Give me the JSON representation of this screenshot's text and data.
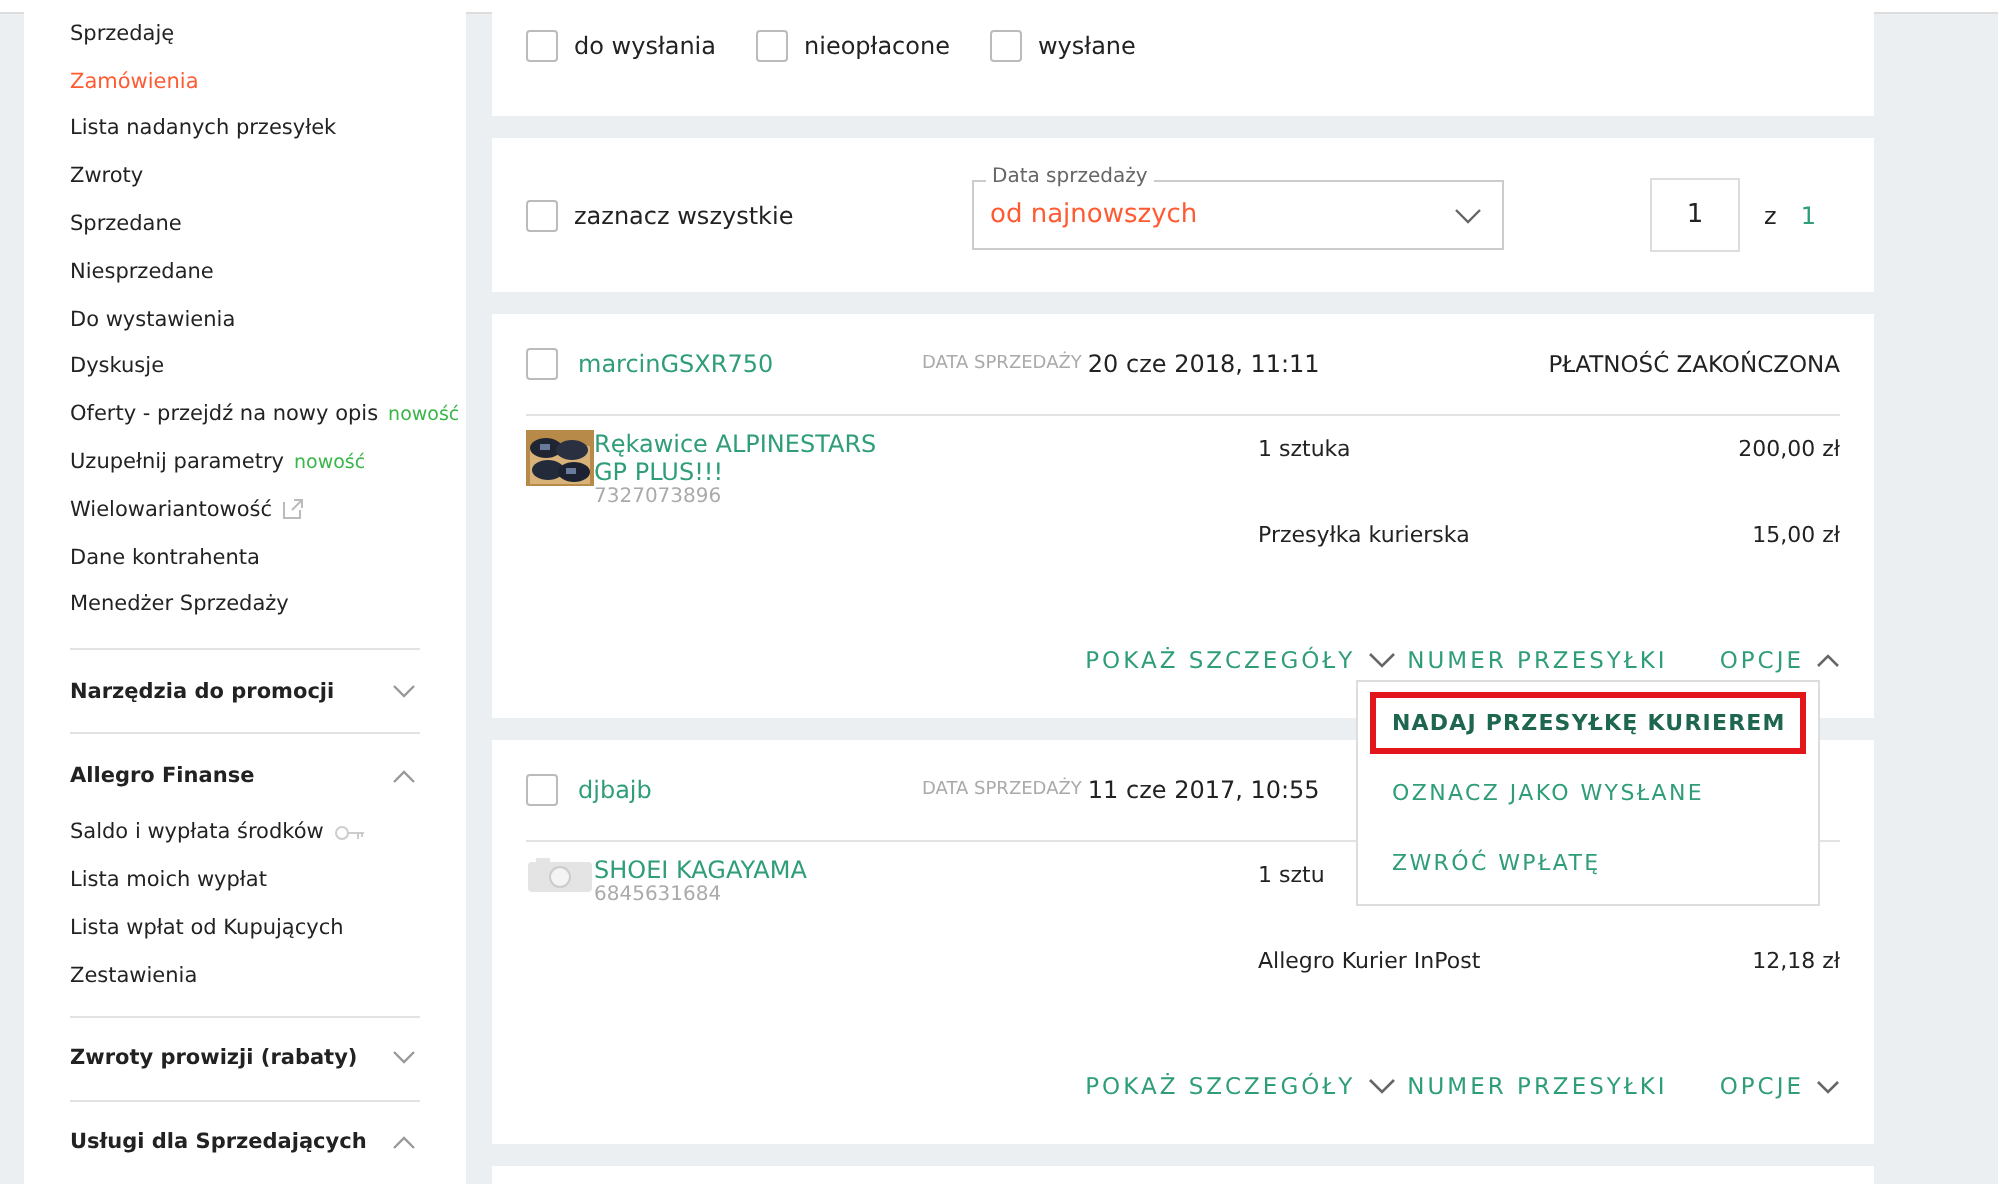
{
  "sidebar": {
    "items": [
      {
        "label": "Sprzedaję",
        "selected": false
      },
      {
        "label": "Zamówienia",
        "selected": true
      },
      {
        "label": "Lista nadanych przesyłek",
        "selected": false
      },
      {
        "label": "Zwroty",
        "selected": false
      },
      {
        "label": "Sprzedane",
        "selected": false
      },
      {
        "label": "Niesprzedane",
        "selected": false
      },
      {
        "label": "Do wystawienia",
        "selected": false
      },
      {
        "label": "Dyskusje",
        "selected": false
      },
      {
        "label": "Oferty - przejdź na nowy opis",
        "selected": false,
        "badge": "nowość"
      },
      {
        "label": "Uzupełnij parametry",
        "selected": false,
        "badge": "nowość"
      },
      {
        "label": "Wielowariantowość",
        "selected": false,
        "kind": "external"
      },
      {
        "label": "Dane kontrahenta",
        "selected": false
      },
      {
        "label": "Menedżer Sprzedaży",
        "selected": false
      }
    ],
    "sections": [
      {
        "title": "Narzędzia do promocji",
        "expanded": false
      },
      {
        "title": "Allegro Finanse",
        "expanded": true,
        "items": [
          {
            "label": "Saldo i wypłata środków",
            "kind": "key"
          },
          {
            "label": "Lista moich wypłat"
          },
          {
            "label": "Lista wpłat od Kupujących"
          },
          {
            "label": "Zestawienia"
          }
        ]
      },
      {
        "title": "Zwroty prowizji (rabaty)",
        "expanded": false
      },
      {
        "title": "Usługi dla Sprzedających",
        "expanded": true
      }
    ]
  },
  "filters": [
    {
      "label": "do wysłania",
      "checked": false
    },
    {
      "label": "nieopłacone",
      "checked": false
    },
    {
      "label": "wysłane",
      "checked": false
    }
  ],
  "toolbar": {
    "select_all": {
      "label": "zaznacz wszystkie",
      "checked": false
    },
    "sort": {
      "label": "Data sprzedaży",
      "value": "od najnowszych"
    },
    "page": {
      "value": "1",
      "of": "z",
      "total": "1"
    }
  },
  "orders": [
    {
      "buyer": "marcinGSXR750",
      "checked": false,
      "date_label": "DATA SPRZEDAŻY",
      "date": "20 cze 2018, 11:11",
      "status": "PŁATNOŚĆ ZAKOŃCZONA",
      "item": {
        "title": "Rękawice ALPINESTARS GP PLUS!!!",
        "number": "7327073896",
        "kind": "picture"
      },
      "quantity": "1 sztuka",
      "price": "200,00 zł",
      "shipping": "Przesyłka kurierska",
      "shipping_price": "15,00 zł",
      "details": "POKAŻ SZCZEGÓŁY",
      "tracking": "NUMER PRZESYŁKI",
      "options": "OPCJE",
      "options_open": true
    },
    {
      "buyer": "djbajb",
      "checked": false,
      "date_label": "DATA SPRZEDAŻY",
      "date": "11 cze 2017, 10:55",
      "item": {
        "title": "SHOEI KAGAYAMA",
        "number": "6845631684",
        "kind": "placeholder"
      },
      "quantity": "1 sztu",
      "shipping": "Allegro Kurier InPost",
      "shipping_price": "12,18 zł",
      "details": "POKAŻ SZCZEGÓŁY",
      "tracking": "NUMER PRZESYŁKI",
      "options": "OPCJE",
      "options_open": false
    }
  ],
  "options_menu": [
    {
      "label": "NADAJ PRZESYŁKĘ KURIEREM",
      "selected": true
    },
    {
      "label": "OZNACZ JAKO WYSŁANE",
      "selected": false
    },
    {
      "label": "ZWRÓĆ WPŁATĘ",
      "selected": false
    }
  ]
}
